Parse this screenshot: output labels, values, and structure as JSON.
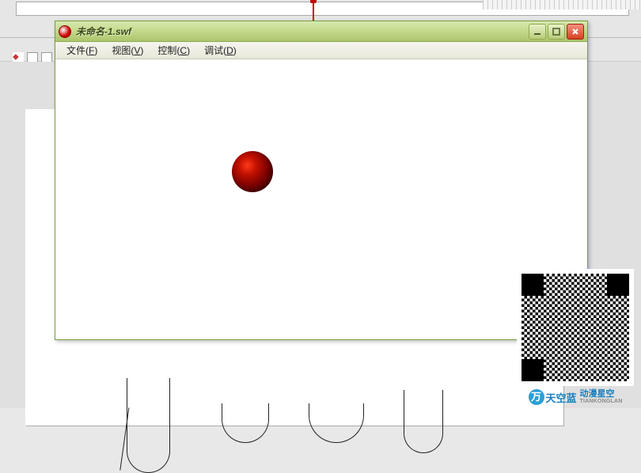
{
  "background": {
    "app_hint": "Flash IDE timeline (behind player window)"
  },
  "swf_window": {
    "title": "未命名-1.swf",
    "menus": {
      "file": {
        "label": "文件",
        "shortcut": "F"
      },
      "view": {
        "label": "视图",
        "shortcut": "V"
      },
      "control": {
        "label": "控制",
        "shortcut": "C"
      },
      "debug": {
        "label": "调试",
        "shortcut": "D"
      }
    },
    "controls": {
      "minimize": "minimize",
      "maximize": "maximize",
      "close": "close"
    },
    "content_object": "red-sphere"
  },
  "watermark": {
    "brand_cn_main": "天空蓝",
    "brand_cn_sub": "动漫星空",
    "brand_en": "TIANKONGLAN"
  }
}
